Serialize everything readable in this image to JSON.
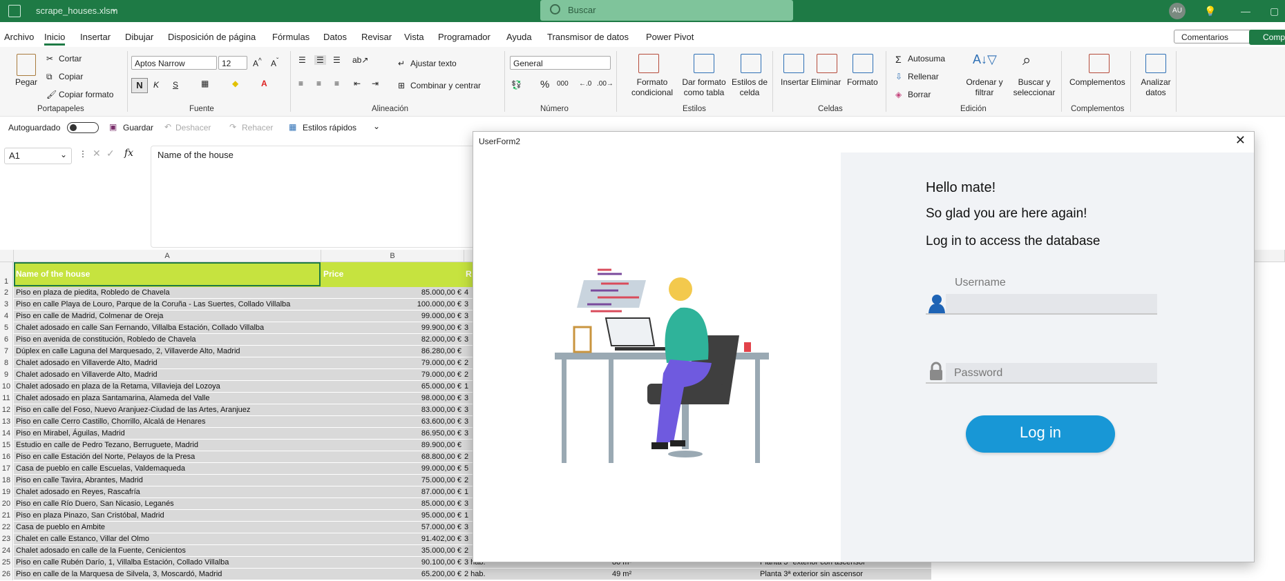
{
  "app": {
    "filename": "scrape_houses.xlsm",
    "search_placeholder": "Buscar",
    "avatar": "AU"
  },
  "menu": {
    "tabs": [
      "Archivo",
      "Inicio",
      "Insertar",
      "Dibujar",
      "Disposición de página",
      "Fórmulas",
      "Datos",
      "Revisar",
      "Vista",
      "Programador",
      "Ayuda",
      "Transmisor de datos",
      "Power Pivot"
    ],
    "comments": "Comentarios",
    "share": "Comp"
  },
  "ribbon": {
    "clipboard": {
      "paste": "Pegar",
      "cut": "Cortar",
      "copy": "Copiar",
      "format_painter": "Copiar formato",
      "group": "Portapapeles"
    },
    "font": {
      "name": "Aptos Narrow",
      "size": "12",
      "bold": "N",
      "italic": "K",
      "underline": "S",
      "group": "Fuente"
    },
    "alignment": {
      "wrap": "Ajustar texto",
      "merge": "Combinar y centrar",
      "group": "Alineación"
    },
    "number": {
      "format": "General",
      "group": "Número"
    },
    "styles": {
      "cond": "Formato condicional",
      "table": "Dar formato como tabla",
      "cell": "Estilos de celda",
      "group": "Estilos"
    },
    "cells": {
      "insert": "Insertar",
      "delete": "Eliminar",
      "format": "Formato",
      "group": "Celdas"
    },
    "editing": {
      "autosum": "Autosuma",
      "fill": "Rellenar",
      "clear": "Borrar",
      "sort": "Ordenar y filtrar",
      "find": "Buscar y seleccionar",
      "group": "Edición"
    },
    "addins": {
      "label": "Complementos",
      "group": "Complementos"
    },
    "analyze": {
      "label": "Analizar datos"
    }
  },
  "qat": {
    "autosave": "Autoguardado",
    "save": "Guardar",
    "undo": "Deshacer",
    "redo": "Rehacer",
    "styles": "Estilos rápidos"
  },
  "formula_bar": {
    "cell_ref": "A1",
    "fx": "fx",
    "content": "Name of the house"
  },
  "sheet": {
    "columns": [
      "A",
      "B"
    ],
    "header": {
      "a": "Name of the house",
      "b": "Price"
    },
    "rows": [
      {
        "n": "2",
        "a": "Piso en plaza de piedita, Robledo de Chavela",
        "b": "85.000,00 €",
        "c": "4"
      },
      {
        "n": "3",
        "a": "Piso en calle Playa de Louro, Parque de la Coruña - Las Suertes, Collado Villalba",
        "b": "100.000,00 €",
        "c": "3"
      },
      {
        "n": "4",
        "a": "Piso en calle de Madrid, Colmenar de Oreja",
        "b": "99.000,00 €",
        "c": "3"
      },
      {
        "n": "5",
        "a": "Chalet adosado en calle San Fernando, Villalba Estación, Collado Villalba",
        "b": "99.900,00 €",
        "c": "3"
      },
      {
        "n": "6",
        "a": "Piso en avenida de constitución, Robledo de Chavela",
        "b": "82.000,00 €",
        "c": "3"
      },
      {
        "n": "7",
        "a": "Dúplex en calle Laguna del Marquesado, 2, Villaverde Alto, Madrid",
        "b": "86.280,00 €",
        "c": ""
      },
      {
        "n": "8",
        "a": "Chalet adosado en Villaverde Alto, Madrid",
        "b": "79.000,00 €",
        "c": "2"
      },
      {
        "n": "9",
        "a": "Chalet adosado en Villaverde Alto, Madrid",
        "b": "79.000,00 €",
        "c": "2"
      },
      {
        "n": "10",
        "a": "Chalet adosado en plaza de la Retama, Villavieja del Lozoya",
        "b": "65.000,00 €",
        "c": "1"
      },
      {
        "n": "11",
        "a": "Chalet adosado en plaza Santamarina, Alameda del Valle",
        "b": "98.000,00 €",
        "c": "3"
      },
      {
        "n": "12",
        "a": "Piso en calle del Foso, Nuevo Aranjuez-Ciudad de las Artes, Aranjuez",
        "b": "83.000,00 €",
        "c": "3"
      },
      {
        "n": "13",
        "a": "Piso en calle Cerro Castillo, Chorrillo, Alcalá de Henares",
        "b": "63.600,00 €",
        "c": "3"
      },
      {
        "n": "14",
        "a": "Piso en Mirabel, Águilas, Madrid",
        "b": "86.950,00 €",
        "c": "3"
      },
      {
        "n": "15",
        "a": "Estudio en calle de Pedro Tezano, Berruguete, Madrid",
        "b": "89.900,00 €",
        "c": ""
      },
      {
        "n": "16",
        "a": "Piso en calle Estación del Norte, Pelayos de la Presa",
        "b": "68.800,00 €",
        "c": "2"
      },
      {
        "n": "17",
        "a": "Casa de pueblo en calle Escuelas, Valdemaqueda",
        "b": "99.000,00 €",
        "c": "5"
      },
      {
        "n": "18",
        "a": "Piso en calle Tavira, Abrantes, Madrid",
        "b": "75.000,00 €",
        "c": "2"
      },
      {
        "n": "19",
        "a": "Chalet adosado en Reyes, Rascafría",
        "b": "87.000,00 €",
        "c": "1"
      },
      {
        "n": "20",
        "a": "Piso en calle Río Duero, San Nicasio, Leganés",
        "b": "85.000,00 €",
        "c": "3"
      },
      {
        "n": "21",
        "a": "Piso en plaza Pinazo, San Cristóbal, Madrid",
        "b": "95.000,00 €",
        "c": "1"
      },
      {
        "n": "22",
        "a": "Casa de pueblo en Ambite",
        "b": "57.000,00 €",
        "c": "3"
      },
      {
        "n": "23",
        "a": "Chalet en calle Estanco, Villar del Olmo",
        "b": "91.402,00 €",
        "c": "3"
      },
      {
        "n": "24",
        "a": "Chalet adosado en calle de la Fuente, Cenicientos",
        "b": "35.000,00 €",
        "c": "2"
      },
      {
        "n": "25",
        "a": "Piso en calle Rubén Darío, 1, Villalba Estación, Collado Villalba",
        "b": "90.100,00 €",
        "c": "3 hab.",
        "d": "80 m²",
        "e": "Planta 3ª exterior con ascensor"
      },
      {
        "n": "26",
        "a": "Piso en calle de la Marquesa de Silvela, 3, Moscardó, Madrid",
        "b": "65.200,00 €",
        "c": "2 hab.",
        "d": "49 m²",
        "e": "Planta 3ª exterior sin ascensor"
      }
    ]
  },
  "userform": {
    "title": "UserForm2",
    "greeting": "Hello mate!",
    "subtitle": "So glad you are here again!",
    "instruction": "Log in to access the database",
    "username_placeholder": "Username",
    "password_placeholder": "Password",
    "login": "Log in",
    "colors": {
      "button": "#1897d6",
      "right_panel": "#f1f3f6"
    }
  }
}
